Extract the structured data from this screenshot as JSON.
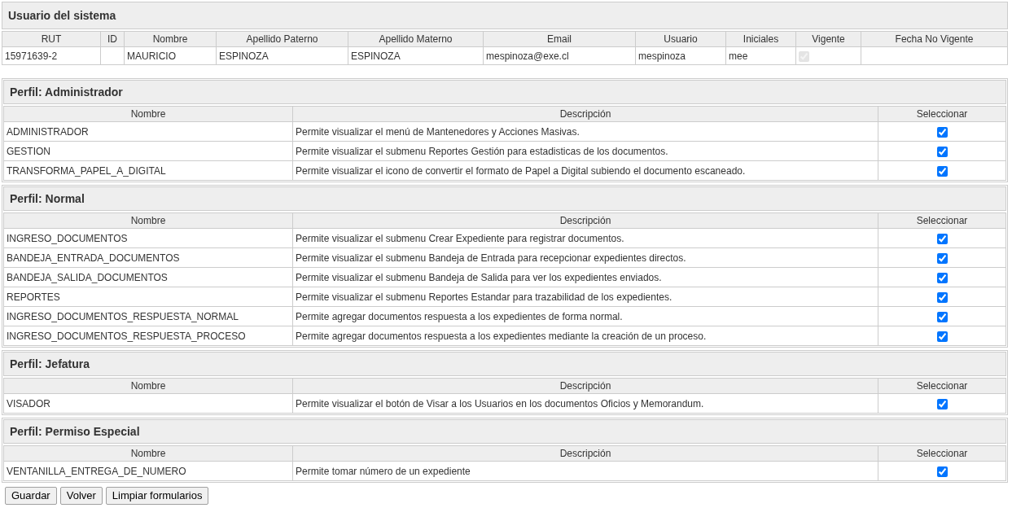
{
  "user_section": {
    "title": "Usuario del sistema",
    "columns": [
      "RUT",
      "ID",
      "Nombre",
      "Apellido Paterno",
      "Apellido Materno",
      "Email",
      "Usuario",
      "Iniciales",
      "Vigente",
      "Fecha No Vigente"
    ],
    "cells": [
      {
        "kind": "text",
        "text": "15971639-2"
      },
      {
        "kind": "empty"
      },
      {
        "kind": "text",
        "text": "MAURICIO"
      },
      {
        "kind": "text",
        "text": "ESPINOZA"
      },
      {
        "kind": "text",
        "text": "ESPINOZA"
      },
      {
        "kind": "text",
        "text": "mespinoza@exe.cl"
      },
      {
        "kind": "text",
        "text": "mespinoza"
      },
      {
        "kind": "text",
        "text": "mee"
      },
      {
        "kind": "checkbox",
        "checked": true,
        "disabled": true
      },
      {
        "kind": "empty"
      }
    ]
  },
  "profiles": [
    {
      "title": "Perfil: Administrador",
      "columns": [
        "Nombre",
        "Descripción",
        "Seleccionar"
      ],
      "rows": [
        {
          "name": "ADMINISTRADOR",
          "description": "Permite visualizar el menú de Mantenedores y Acciones Masivas.",
          "checked": true
        },
        {
          "name": "GESTION",
          "description": "Permite visualizar el submenu Reportes Gestión para estadisticas de los documentos.",
          "checked": true
        },
        {
          "name": "TRANSFORMA_PAPEL_A_DIGITAL",
          "description": "Permite visualizar el icono de convertir el formato de Papel a Digital subiendo el documento escaneado.",
          "checked": true
        }
      ]
    },
    {
      "title": "Perfil: Normal",
      "columns": [
        "Nombre",
        "Descripción",
        "Seleccionar"
      ],
      "rows": [
        {
          "name": "INGRESO_DOCUMENTOS",
          "description": "Permite visualizar el submenu Crear Expediente para registrar documentos.",
          "checked": true
        },
        {
          "name": "BANDEJA_ENTRADA_DOCUMENTOS",
          "description": "Permite visualizar el submenu Bandeja de Entrada para recepcionar expedientes directos.",
          "checked": true
        },
        {
          "name": "BANDEJA_SALIDA_DOCUMENTOS",
          "description": "Permite visualizar el submenu Bandeja de Salida para ver los expedientes enviados.",
          "checked": true
        },
        {
          "name": "REPORTES",
          "description": "Permite visualizar el submenu Reportes Estandar para trazabilidad de los expedientes.",
          "checked": true
        },
        {
          "name": "INGRESO_DOCUMENTOS_RESPUESTA_NORMAL",
          "description": "Permite agregar documentos respuesta a los expedientes de forma normal.",
          "checked": true
        },
        {
          "name": "INGRESO_DOCUMENTOS_RESPUESTA_PROCESO",
          "description": "Permite agregar documentos respuesta a los expedientes mediante la creación de un proceso.",
          "checked": true
        }
      ]
    },
    {
      "title": "Perfil: Jefatura",
      "columns": [
        "Nombre",
        "Descripción",
        "Seleccionar"
      ],
      "rows": [
        {
          "name": "VISADOR",
          "description": "Permite visualizar el botón de Visar a los Usuarios en los documentos Oficios y Memorandum.",
          "checked": true
        }
      ]
    },
    {
      "title": "Perfil: Permiso Especial",
      "columns": [
        "Nombre",
        "Descripción",
        "Seleccionar"
      ],
      "rows": [
        {
          "name": "VENTANILLA_ENTREGA_DE_NUMERO",
          "description": "Permite tomar número de un expediente",
          "checked": true
        }
      ]
    }
  ],
  "buttons": [
    "Guardar",
    "Volver",
    "Limpiar formularios"
  ]
}
